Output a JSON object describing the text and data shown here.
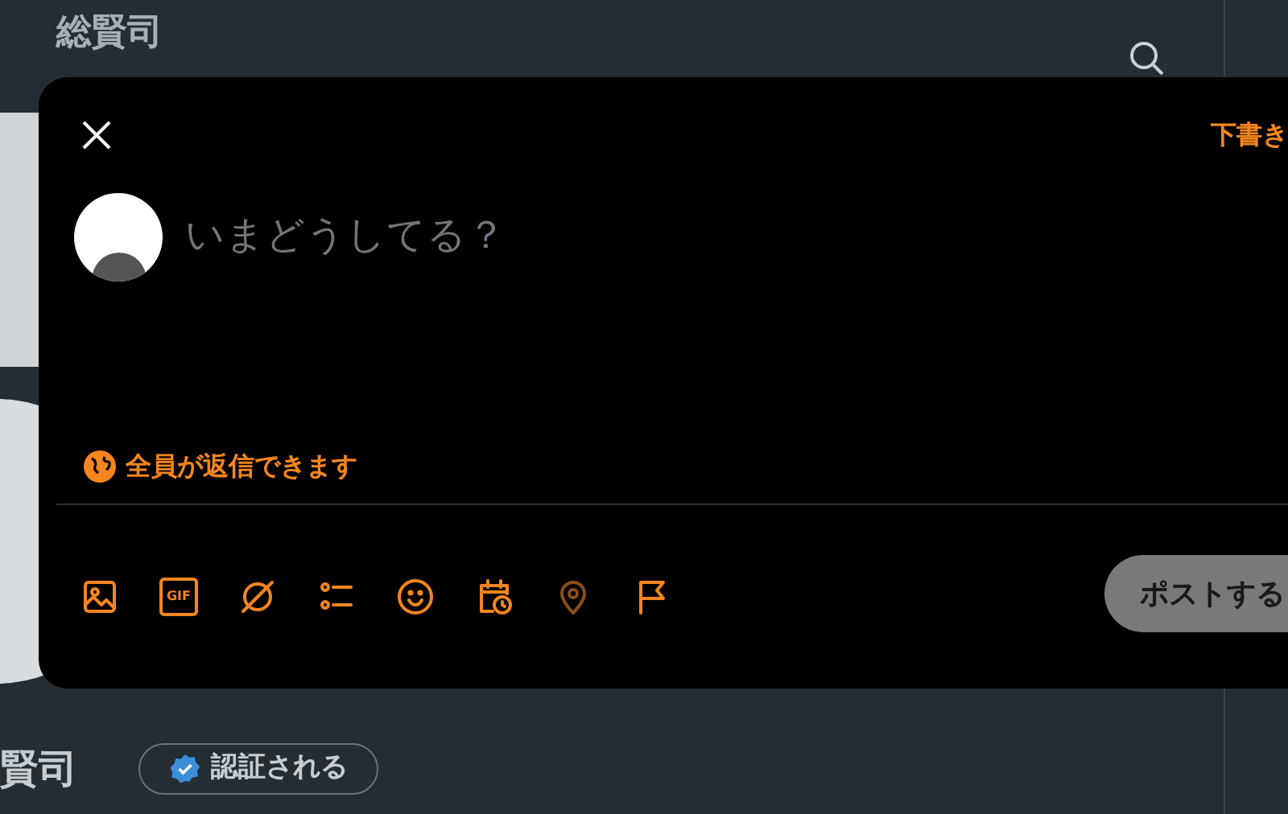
{
  "header": {
    "title": "総賢司"
  },
  "profile": {
    "name": "賢司",
    "verify_button": "認証される"
  },
  "composer": {
    "draft_button": "下書き",
    "placeholder": "いまどうしてる？",
    "reply_setting": "全員が返信できます",
    "post_button": "ポストする",
    "tools": [
      {
        "kind": "image",
        "disabled": false
      },
      {
        "kind": "gif",
        "label": "GIF",
        "disabled": false
      },
      {
        "kind": "grok",
        "disabled": false
      },
      {
        "kind": "poll",
        "disabled": false
      },
      {
        "kind": "emoji",
        "disabled": false
      },
      {
        "kind": "schedule",
        "disabled": false
      },
      {
        "kind": "location",
        "disabled": true
      },
      {
        "kind": "flag",
        "disabled": false
      }
    ]
  }
}
